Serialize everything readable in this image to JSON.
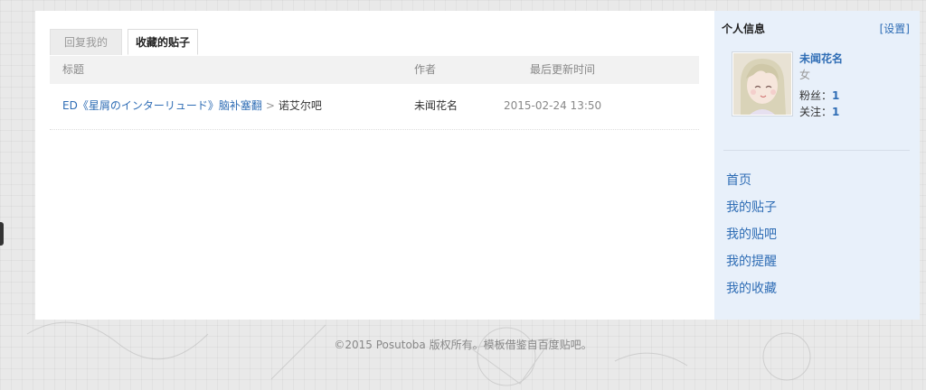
{
  "tabs": {
    "replies": "回复我的",
    "favorites": "收藏的贴子"
  },
  "table": {
    "headers": {
      "title": "标题",
      "author": "作者",
      "updated": "最后更新时间"
    },
    "rows": [
      {
        "title": "ED《星屑のインターリュード》脑补塞翻",
        "separator": ">",
        "forum": "诺艾尔吧",
        "author": "未闻花名",
        "updated": "2015-02-24 13:50"
      }
    ]
  },
  "sidebar": {
    "title": "个人信息",
    "settings": "[设置]",
    "user": {
      "name": "未闻花名",
      "gender": "女",
      "fans_label": "粉丝：",
      "fans": "1",
      "follow_label": "关注：",
      "follow": "1"
    },
    "nav": [
      "首页",
      "我的贴子",
      "我的贴吧",
      "我的提醒",
      "我的收藏"
    ]
  },
  "footer": "©2015 Posutoba 版权所有。模板借鉴自百度贴吧。",
  "colors": {
    "link": "#2f6db5",
    "sidebar_bg": "#e8f0fa",
    "page_bg": "#e9e9e9"
  },
  "icons": {
    "avatar": "anime-girl-avatar"
  }
}
